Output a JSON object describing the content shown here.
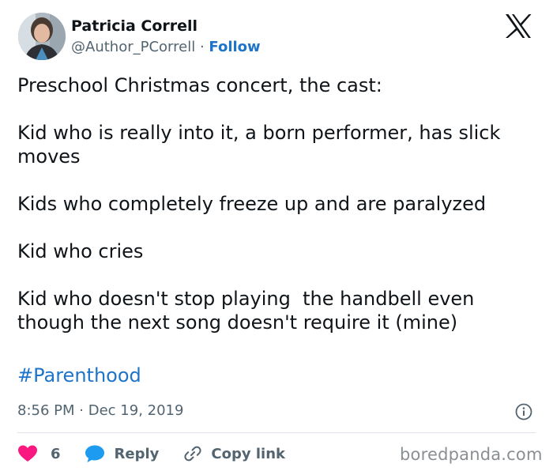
{
  "author": {
    "display_name": "Patricia Correll",
    "handle": "@Author_PCorrell",
    "separator": "·",
    "follow_label": "Follow"
  },
  "tweet": {
    "paragraphs": [
      "Preschool Christmas concert, the cast:",
      "Kid who is really into it, a born performer, has slick moves",
      "Kids who completely freeze up and are paralyzed",
      "Kid who cries",
      "Kid who doesn't stop playing  the handbell even though the next song doesn't require it (mine)"
    ],
    "hashtag": "#Parenthood",
    "time": "8:56 PM",
    "date_separator": "·",
    "date": "Dec 19, 2019"
  },
  "actions": {
    "like_count": "6",
    "reply_label": "Reply",
    "copy_link_label": "Copy link"
  },
  "watermark": "boredpanda.com",
  "colors": {
    "link_blue": "#1d74c8",
    "like_red": "#f91880",
    "reply_blue": "#1d9bf0",
    "muted_gray": "#536471"
  },
  "icons": {
    "platform_logo": "x-logo-icon",
    "info": "info-icon",
    "like": "heart-icon",
    "reply": "speech-bubble-icon",
    "copy_link": "link-icon"
  }
}
